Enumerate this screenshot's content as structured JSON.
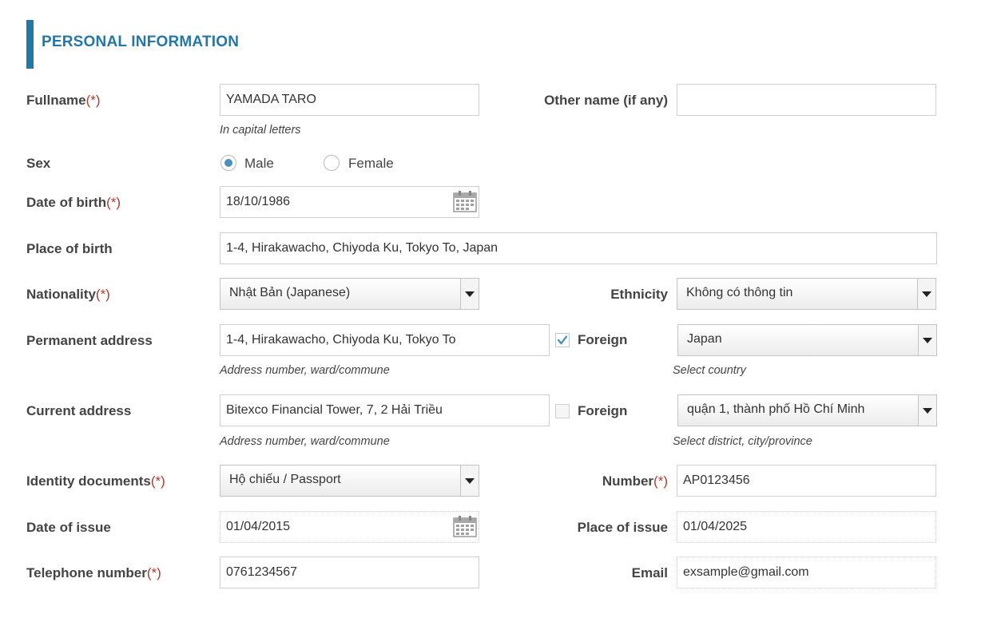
{
  "section": {
    "title": "PERSONAL INFORMATION"
  },
  "required_mark": "(*)",
  "fullname": {
    "label": "Fullname",
    "value": "YAMADA TARO",
    "hint": "In capital letters"
  },
  "other_name": {
    "label": "Other name (if any)",
    "value": ""
  },
  "sex": {
    "label": "Sex",
    "options": [
      "Male",
      "Female"
    ],
    "selected": "Male"
  },
  "dob": {
    "label": "Date of birth",
    "value": "18/10/1986"
  },
  "place_of_birth": {
    "label": "Place of birth",
    "value": "1-4, Hirakawacho, Chiyoda Ku, Tokyo To, Japan"
  },
  "nationality": {
    "label": "Nationality",
    "value": "Nhật Bản (Japanese)"
  },
  "ethnicity": {
    "label": "Ethnicity",
    "value": "Không có thông tin"
  },
  "permanent_address": {
    "label": "Permanent address",
    "value": "1-4, Hirakawacho, Chiyoda Ku, Tokyo To",
    "hint": "Address number, ward/commune",
    "foreign_label": "Foreign",
    "foreign_checked": true,
    "country": "Japan",
    "country_hint": "Select country"
  },
  "current_address": {
    "label": "Current address",
    "value": "Bitexco Financial Tower, 7, 2 Hải Triều",
    "hint": "Address number, ward/commune",
    "foreign_label": "Foreign",
    "foreign_checked": false,
    "district": "quận 1, thành phố Hồ Chí Minh",
    "district_hint": "Select district, city/province"
  },
  "identity": {
    "label": "Identity documents",
    "value": "Hộ chiếu / Passport"
  },
  "number": {
    "label": "Number",
    "value": "AP0123456"
  },
  "date_of_issue": {
    "label": "Date of issue",
    "value": "01/04/2015"
  },
  "place_of_issue": {
    "label": "Place of issue",
    "value": "01/04/2025"
  },
  "telephone": {
    "label": "Telephone number",
    "value": "0761234567"
  },
  "email": {
    "label": "Email",
    "value": "exsample@gmail.com"
  },
  "icons": {
    "calendar": "calendar-icon",
    "dropdown": "chevron-down-icon",
    "check": "checkmark-icon"
  },
  "colors": {
    "accent": "#2478a8",
    "required": "#b03a2e",
    "radio_selected": "#4e8fc0"
  }
}
